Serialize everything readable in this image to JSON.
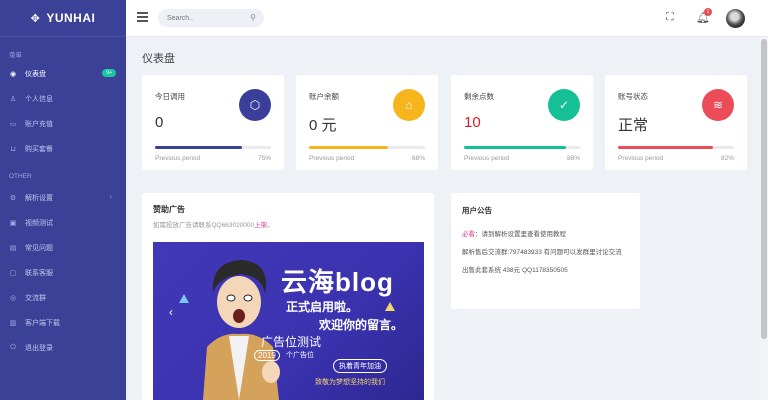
{
  "brand": {
    "name": "YUNHAI"
  },
  "sidebar": {
    "section_menu": "菜单",
    "section_other": "OTHER",
    "items": [
      {
        "label": "仪表盘",
        "icon": "dashboard-icon",
        "badge": "9+"
      },
      {
        "label": "个人信息",
        "icon": "user-icon"
      },
      {
        "label": "账户充值",
        "icon": "card-icon"
      },
      {
        "label": "购买套餐",
        "icon": "cart-icon"
      }
    ],
    "other_items": [
      {
        "label": "解析设置",
        "icon": "gear-icon"
      },
      {
        "label": "视频测试",
        "icon": "video-icon"
      },
      {
        "label": "常见问题",
        "icon": "doc-icon"
      },
      {
        "label": "联系客服",
        "icon": "chat-icon"
      },
      {
        "label": "交流群",
        "icon": "group-icon"
      },
      {
        "label": "客户端下载",
        "icon": "download-icon"
      },
      {
        "label": "退出登录",
        "icon": "power-icon"
      }
    ]
  },
  "topbar": {
    "search_placeholder": "Search..",
    "notification_count": "1"
  },
  "page_title": "仪表盘",
  "stats": [
    {
      "label": "今日调用",
      "value": "0",
      "footer_label": "Previous period",
      "footer_value": "75%",
      "progress": 0.75,
      "color": "#3a3f9a",
      "icon": "cube-icon"
    },
    {
      "label": "账户余额",
      "value": "0 元",
      "footer_label": "Previous period",
      "footer_value": "68%",
      "progress": 0.68,
      "color": "#f6b51c",
      "icon": "tag-icon"
    },
    {
      "label": "剩余点数",
      "value": "10",
      "footer_label": "Previous period",
      "footer_value": "88%",
      "progress": 0.88,
      "color": "#16c095",
      "icon": "clipboard-icon"
    },
    {
      "label": "账号状态",
      "value": "正常",
      "footer_label": "Previous period",
      "footer_value": "82%",
      "progress": 0.82,
      "color": "#ec4c58",
      "icon": "layers-icon"
    }
  ],
  "ad": {
    "title": "赞助广告",
    "subtitle_prefix": "如需投放广告请联系QQ663020000",
    "subtitle_link": "上架",
    "subtitle_suffix": "。",
    "banner_big": "云海blog",
    "banner_line1": "正式启用啦。",
    "banner_line2": "欢迎你的留言。",
    "banner_ad_test": "广告位测试",
    "banner_year": "2019",
    "banner_pos": "个广告位",
    "banner_pill": "执着青年加油",
    "banner_small": "致敬为梦想坚持的我们"
  },
  "notice": {
    "title": "用户公告",
    "must": "必看",
    "row1": "：请到解析设置里查看使用教程",
    "row2": "解析售后交流群:797483933 有问题可以发群里讨论交流",
    "row3": "出售此套系统 438元 QQ1178350505"
  }
}
